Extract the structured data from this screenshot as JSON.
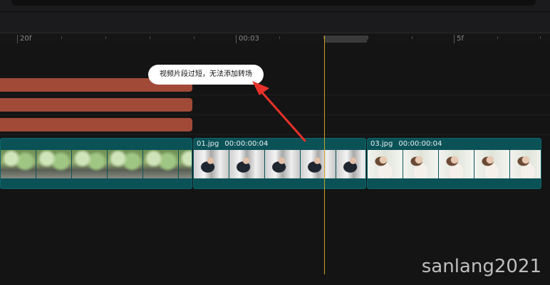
{
  "ruler": {
    "labels": [
      "20f",
      "00:03",
      "5f"
    ]
  },
  "tooltip": {
    "text": "视频片段过短，无法添加转场"
  },
  "clips": [
    {
      "name": "",
      "duration": ""
    },
    {
      "name": "01.jpg",
      "duration": "00:00:00:04"
    },
    {
      "name": "03.jpg",
      "duration": "00:00:00:04"
    }
  ],
  "colors": {
    "audio_clip": "#a14a38",
    "video_clip": "#0b5257",
    "playhead": "#c9a227",
    "annotation_arrow": "#e8312a"
  },
  "watermark": {
    "text": "sanlang2021"
  }
}
